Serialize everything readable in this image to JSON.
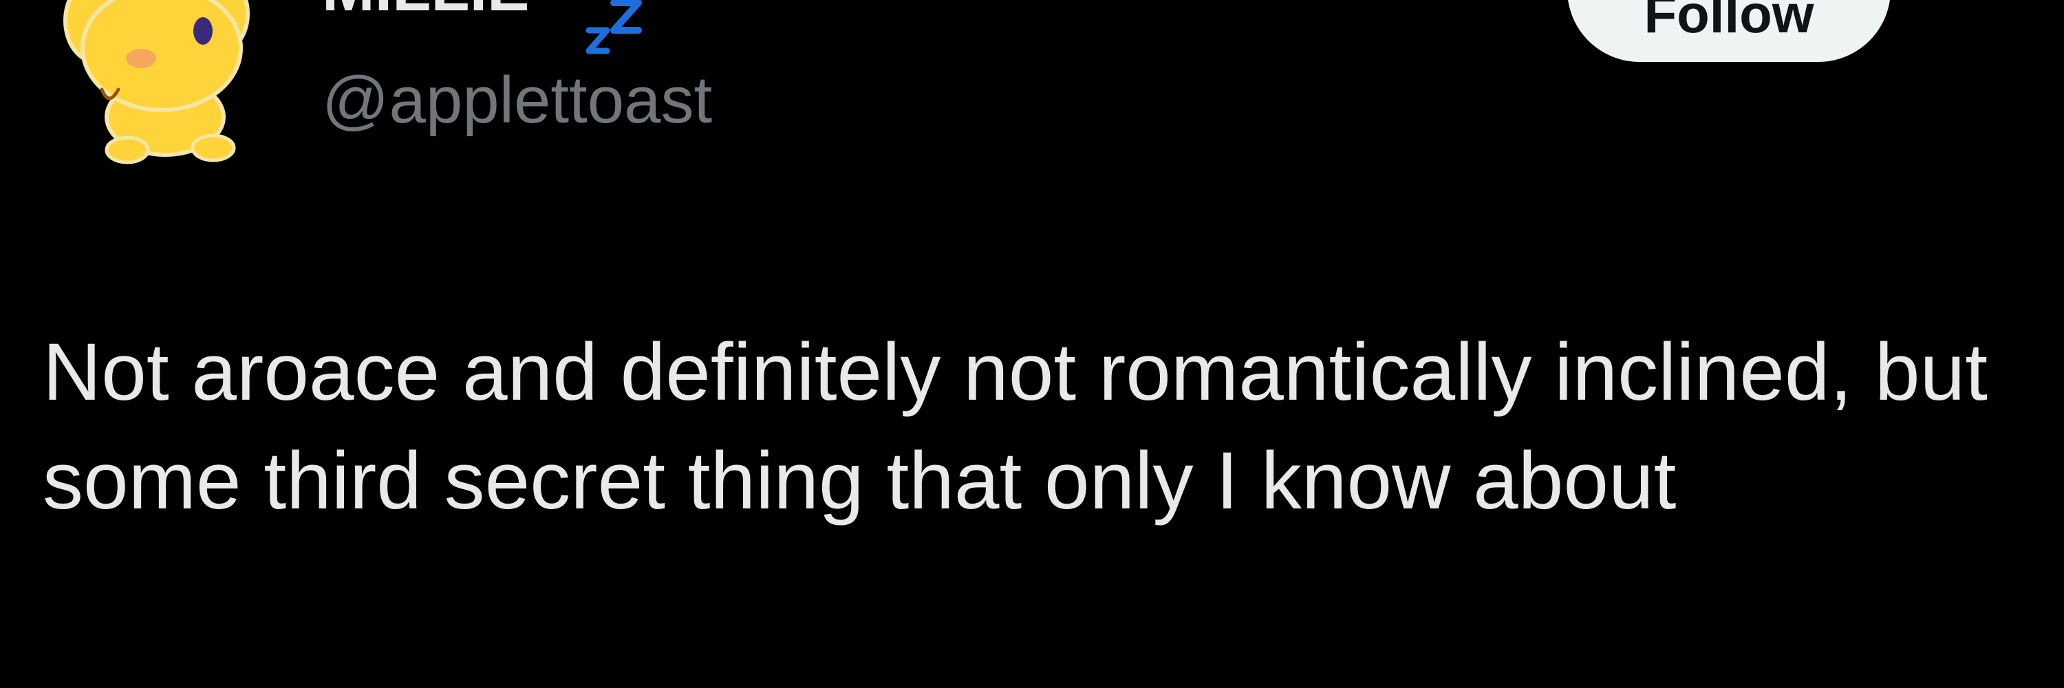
{
  "post": {
    "author": {
      "display_name": "MILLIE",
      "name_emoji": "zzz-icon",
      "handle": "@applettoast",
      "avatar": "yellow-cartoon-dog-avatar"
    },
    "follow_label": "Follow",
    "more_icon": "more-icon",
    "text": "Not aroace and definitely not romantically inclined, but some third secret thing that only I know about"
  },
  "colors": {
    "background": "#000000",
    "primary_text": "#e7e9ea",
    "secondary_text": "#71767b",
    "follow_bg": "#eff3f4",
    "follow_text": "#0f1419",
    "zzz_blue": "#1d6fe0",
    "avatar_yellow": "#ffd43b"
  }
}
